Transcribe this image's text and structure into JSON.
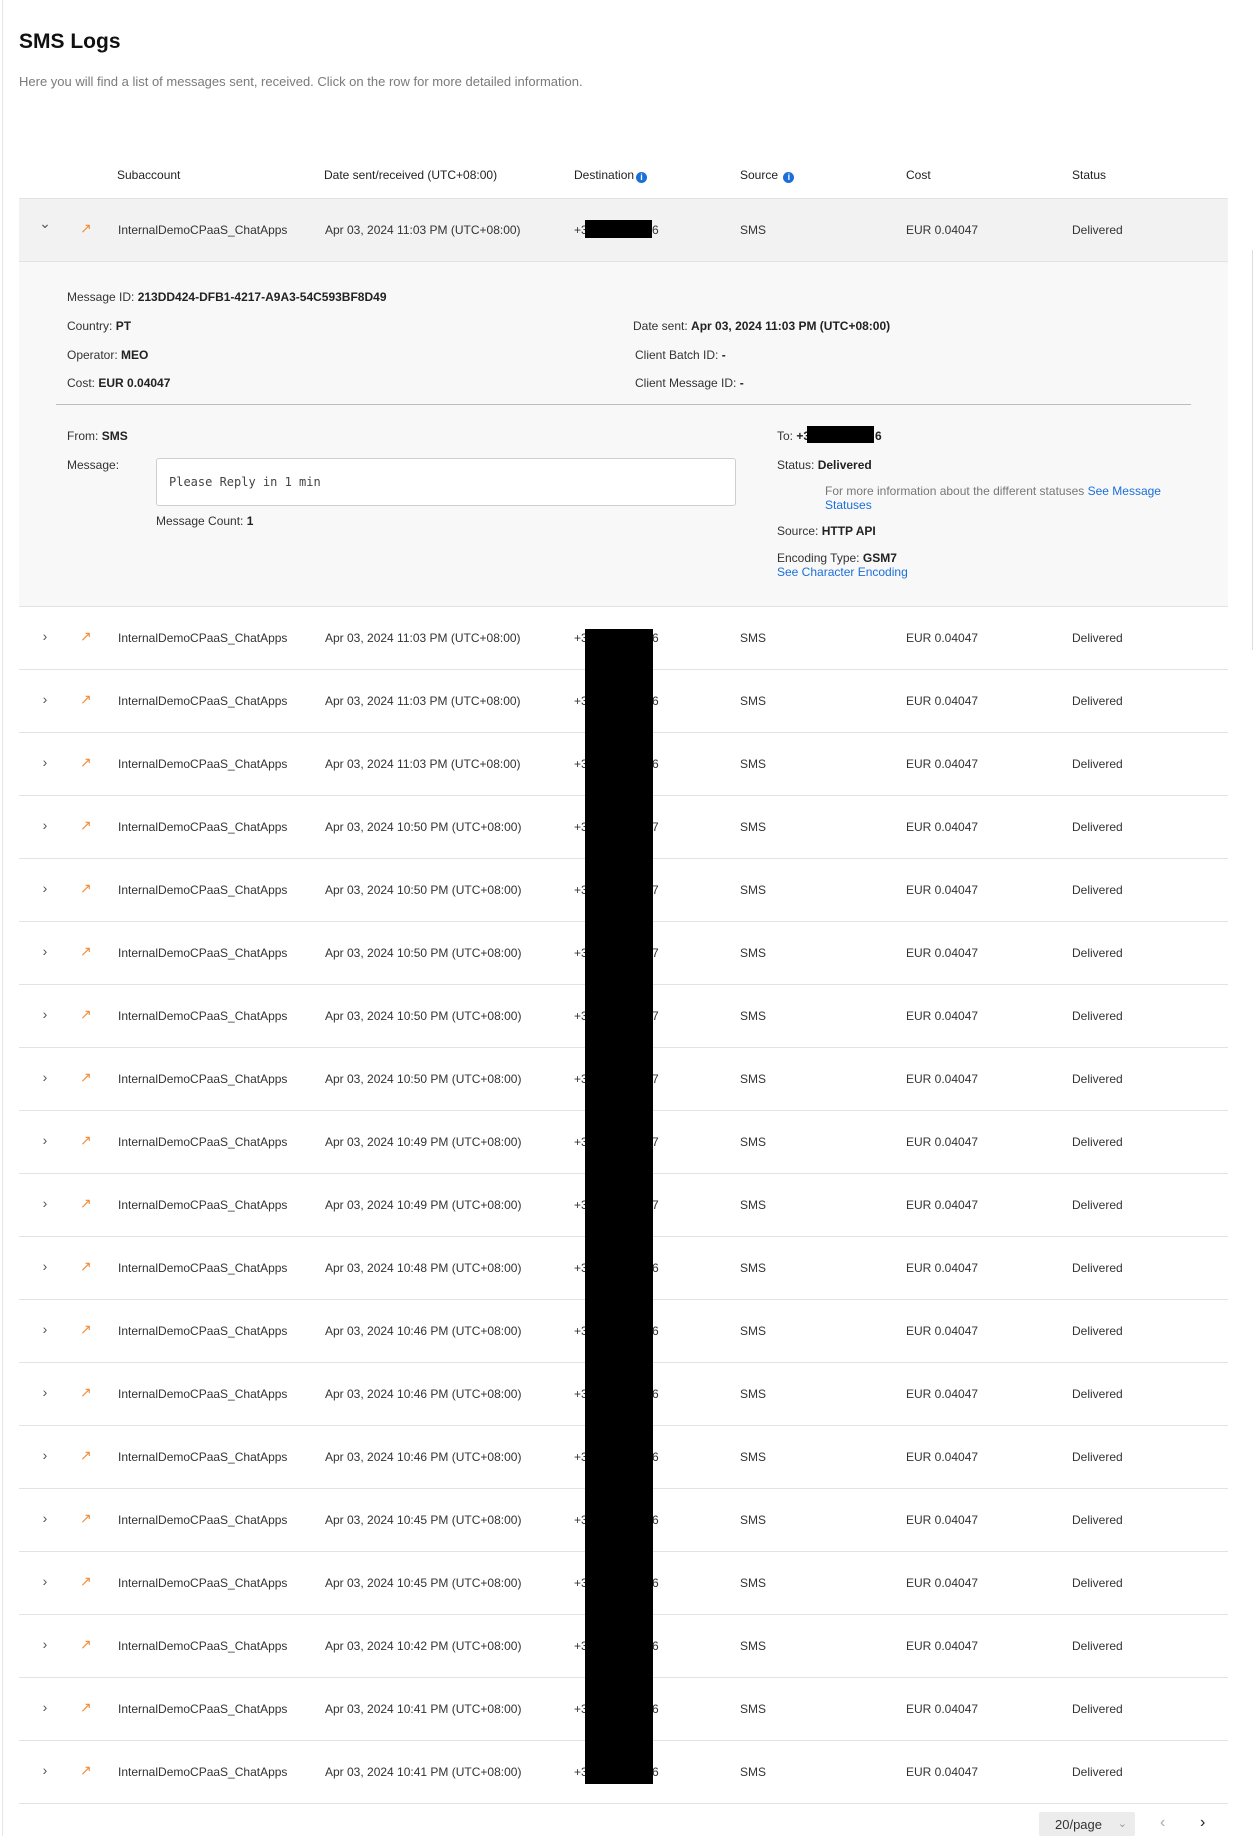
{
  "page": {
    "title": "SMS Logs",
    "subtitle": "Here you will find a list of messages sent, received. Click on the row for more detailed information."
  },
  "table": {
    "headers": {
      "subaccount": "Subaccount",
      "date": "Date sent/received (UTC+08:00)",
      "destination": "Destination",
      "source": "Source",
      "cost": "Cost",
      "status": "Status"
    },
    "rows": [
      {
        "subaccount": "InternalDemoCPaaS_ChatApps",
        "date": "Apr 03, 2024 11:03 PM (UTC+08:00)",
        "dest_prefix": "+3",
        "dest_suffix": "6",
        "source": "SMS",
        "cost": "EUR 0.04047",
        "status": "Delivered"
      },
      {
        "subaccount": "InternalDemoCPaaS_ChatApps",
        "date": "Apr 03, 2024 11:03 PM (UTC+08:00)",
        "dest_prefix": "+3",
        "dest_suffix": "6",
        "source": "SMS",
        "cost": "EUR 0.04047",
        "status": "Delivered"
      },
      {
        "subaccount": "InternalDemoCPaaS_ChatApps",
        "date": "Apr 03, 2024 11:03 PM (UTC+08:00)",
        "dest_prefix": "+3",
        "dest_suffix": "6",
        "source": "SMS",
        "cost": "EUR 0.04047",
        "status": "Delivered"
      },
      {
        "subaccount": "InternalDemoCPaaS_ChatApps",
        "date": "Apr 03, 2024 11:03 PM (UTC+08:00)",
        "dest_prefix": "+3",
        "dest_suffix": "6",
        "source": "SMS",
        "cost": "EUR 0.04047",
        "status": "Delivered"
      },
      {
        "subaccount": "InternalDemoCPaaS_ChatApps",
        "date": "Apr 03, 2024 10:50 PM (UTC+08:00)",
        "dest_prefix": "+3",
        "dest_suffix": "7",
        "source": "SMS",
        "cost": "EUR 0.04047",
        "status": "Delivered"
      },
      {
        "subaccount": "InternalDemoCPaaS_ChatApps",
        "date": "Apr 03, 2024 10:50 PM (UTC+08:00)",
        "dest_prefix": "+3",
        "dest_suffix": "7",
        "source": "SMS",
        "cost": "EUR 0.04047",
        "status": "Delivered"
      },
      {
        "subaccount": "InternalDemoCPaaS_ChatApps",
        "date": "Apr 03, 2024 10:50 PM (UTC+08:00)",
        "dest_prefix": "+3",
        "dest_suffix": "7",
        "source": "SMS",
        "cost": "EUR 0.04047",
        "status": "Delivered"
      },
      {
        "subaccount": "InternalDemoCPaaS_ChatApps",
        "date": "Apr 03, 2024 10:50 PM (UTC+08:00)",
        "dest_prefix": "+3",
        "dest_suffix": "7",
        "source": "SMS",
        "cost": "EUR 0.04047",
        "status": "Delivered"
      },
      {
        "subaccount": "InternalDemoCPaaS_ChatApps",
        "date": "Apr 03, 2024 10:50 PM (UTC+08:00)",
        "dest_prefix": "+3",
        "dest_suffix": "7",
        "source": "SMS",
        "cost": "EUR 0.04047",
        "status": "Delivered"
      },
      {
        "subaccount": "InternalDemoCPaaS_ChatApps",
        "date": "Apr 03, 2024 10:49 PM (UTC+08:00)",
        "dest_prefix": "+3",
        "dest_suffix": "7",
        "source": "SMS",
        "cost": "EUR 0.04047",
        "status": "Delivered"
      },
      {
        "subaccount": "InternalDemoCPaaS_ChatApps",
        "date": "Apr 03, 2024 10:49 PM (UTC+08:00)",
        "dest_prefix": "+3",
        "dest_suffix": "7",
        "source": "SMS",
        "cost": "EUR 0.04047",
        "status": "Delivered"
      },
      {
        "subaccount": "InternalDemoCPaaS_ChatApps",
        "date": "Apr 03, 2024 10:48 PM (UTC+08:00)",
        "dest_prefix": "+3",
        "dest_suffix": "6",
        "source": "SMS",
        "cost": "EUR 0.04047",
        "status": "Delivered"
      },
      {
        "subaccount": "InternalDemoCPaaS_ChatApps",
        "date": "Apr 03, 2024 10:46 PM (UTC+08:00)",
        "dest_prefix": "+3",
        "dest_suffix": "6",
        "source": "SMS",
        "cost": "EUR 0.04047",
        "status": "Delivered"
      },
      {
        "subaccount": "InternalDemoCPaaS_ChatApps",
        "date": "Apr 03, 2024 10:46 PM (UTC+08:00)",
        "dest_prefix": "+3",
        "dest_suffix": "6",
        "source": "SMS",
        "cost": "EUR 0.04047",
        "status": "Delivered"
      },
      {
        "subaccount": "InternalDemoCPaaS_ChatApps",
        "date": "Apr 03, 2024 10:46 PM (UTC+08:00)",
        "dest_prefix": "+3",
        "dest_suffix": "6",
        "source": "SMS",
        "cost": "EUR 0.04047",
        "status": "Delivered"
      },
      {
        "subaccount": "InternalDemoCPaaS_ChatApps",
        "date": "Apr 03, 2024 10:45 PM (UTC+08:00)",
        "dest_prefix": "+3",
        "dest_suffix": "6",
        "source": "SMS",
        "cost": "EUR 0.04047",
        "status": "Delivered"
      },
      {
        "subaccount": "InternalDemoCPaaS_ChatApps",
        "date": "Apr 03, 2024 10:45 PM (UTC+08:00)",
        "dest_prefix": "+3",
        "dest_suffix": "6",
        "source": "SMS",
        "cost": "EUR 0.04047",
        "status": "Delivered"
      },
      {
        "subaccount": "InternalDemoCPaaS_ChatApps",
        "date": "Apr 03, 2024 10:42 PM (UTC+08:00)",
        "dest_prefix": "+3",
        "dest_suffix": "6",
        "source": "SMS",
        "cost": "EUR 0.04047",
        "status": "Delivered"
      },
      {
        "subaccount": "InternalDemoCPaaS_ChatApps",
        "date": "Apr 03, 2024 10:41 PM (UTC+08:00)",
        "dest_prefix": "+3",
        "dest_suffix": "6",
        "source": "SMS",
        "cost": "EUR 0.04047",
        "status": "Delivered"
      },
      {
        "subaccount": "InternalDemoCPaaS_ChatApps",
        "date": "Apr 03, 2024 10:41 PM (UTC+08:00)",
        "dest_prefix": "+3",
        "dest_suffix": "6",
        "source": "SMS",
        "cost": "EUR 0.04047",
        "status": "Delivered"
      }
    ]
  },
  "detail": {
    "message_id_label": "Message ID:",
    "message_id": "213DD424-DFB1-4217-A9A3-54C593BF8D49",
    "country_label": "Country:",
    "country": "PT",
    "operator_label": "Operator:",
    "operator": "MEO",
    "cost_label": "Cost:",
    "cost": "EUR 0.04047",
    "date_sent_label": "Date sent:",
    "date_sent": "Apr 03, 2024 11:03 PM (UTC+08:00)",
    "client_batch_label": "Client Batch ID:",
    "client_batch": "-",
    "client_message_label": "Client Message ID:",
    "client_message": "-",
    "from_label": "From:",
    "from": "SMS",
    "message_label": "Message:",
    "message": "Please Reply in 1 min",
    "message_count_label": "Message Count:",
    "message_count": "1",
    "to_label": "To:",
    "to_prefix": "+3",
    "to_suffix": "6",
    "status_label": "Status:",
    "status": "Delivered",
    "status_info": "For more information about the different statuses",
    "status_link": "See Message Statuses",
    "source_label": "Source:",
    "source": "HTTP API",
    "encoding_label": "Encoding Type:",
    "encoding": "GSM7",
    "encoding_link": "See Character Encoding"
  },
  "pagination": {
    "page_size": "20/page"
  },
  "colors": {
    "accent": "#1b6fd8",
    "outgoing_arrow": "#f28c38",
    "expanded_row_bg": "#f2f2f2",
    "redaction": "#000000"
  },
  "icons": {
    "expand": "chevron-right-icon",
    "collapse": "chevron-down-icon",
    "direction": "outgoing-arrow-icon",
    "info": "info-icon"
  }
}
